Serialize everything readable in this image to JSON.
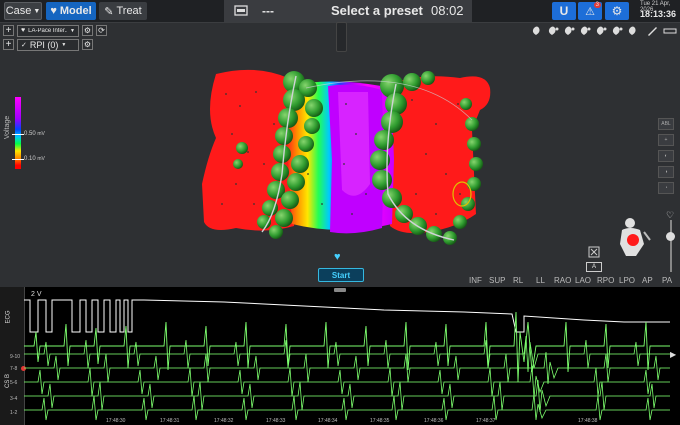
{
  "topbar": {
    "case_label": "Case",
    "model_label": "Model",
    "treat_label": "Treat",
    "preset_dashes": "---",
    "preset_label": "Select a preset",
    "timer": "08:02",
    "notification_count": "3",
    "date": "Tue 21 Apr, 2026",
    "clock": "18:13:36"
  },
  "controls": {
    "row1_map": "LA-Pace Inter...",
    "row2_map": "RPI (0)"
  },
  "voltage_scale": {
    "axis_label": "Voltage",
    "high": "0.50",
    "low": "0.10",
    "unit": "mV"
  },
  "start_label": "Start",
  "views": [
    "INF",
    "SUP",
    "RL",
    "LL",
    "RAO",
    "LAO",
    "RPO",
    "LPO",
    "AP",
    "PA"
  ],
  "view_marker": "A",
  "ecg": {
    "ecg_label": "ECG",
    "cs_label": "CS B",
    "scale": "2 V",
    "cs_channels": [
      "9-10",
      "7-8",
      "5-6",
      "3-4",
      "1-2"
    ],
    "times": [
      "17:48:30",
      "17:48:31",
      "17:48:32",
      "17:48:33",
      "17:48:34",
      "17:48:35",
      "17:48:36",
      "17:48:37",
      "17:48:38"
    ]
  },
  "colors": {
    "accent_blue": "#1565c0",
    "tissue_red": "#ff1a1a",
    "ablation_green": "#2f9c2f",
    "signal_green": "#7dff6e"
  },
  "icons": [
    "heart-icon",
    "wand-icon",
    "bed-icon",
    "magnet-icon",
    "bell-alert-icon",
    "gear-icon"
  ]
}
